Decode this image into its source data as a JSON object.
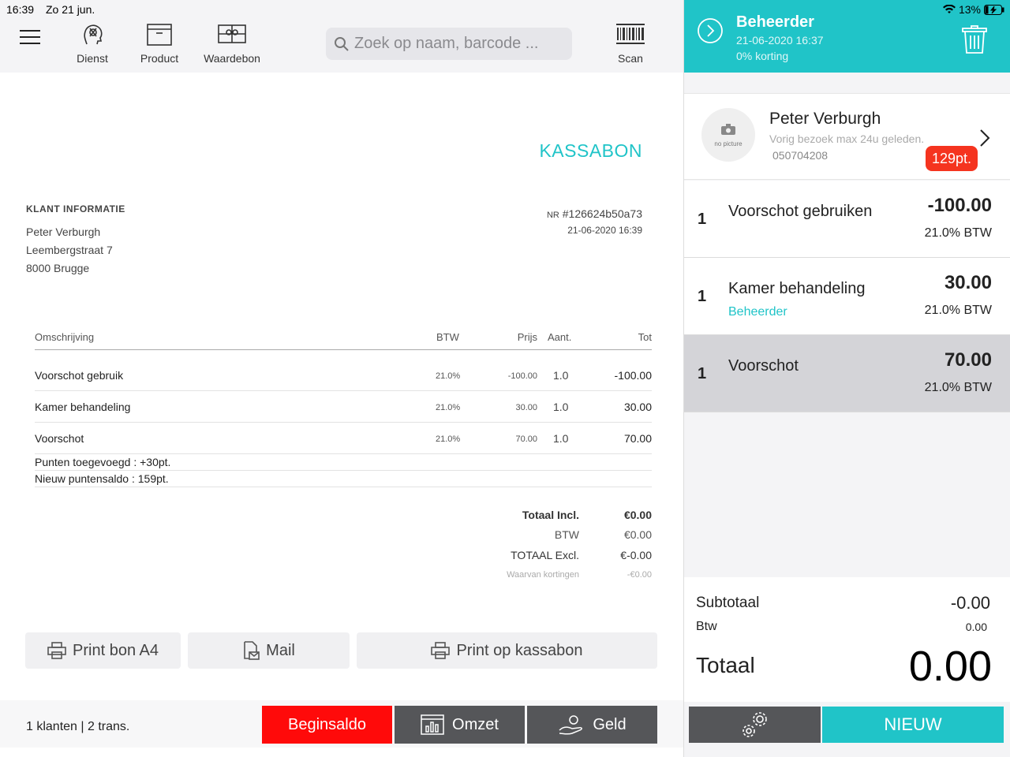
{
  "status": {
    "time": "16:39",
    "date": "Zo 21 jun.",
    "battery": "13%"
  },
  "toolbar": {
    "dienst": "Dienst",
    "product": "Product",
    "waardebon": "Waardebon",
    "search_placeholder": "Zoek op naam, barcode ...",
    "scan": "Scan"
  },
  "receipt": {
    "title": "KASSABON",
    "klant_heading": "KLANT INFORMATIE",
    "klant_name": "Peter Verburgh",
    "klant_street": "Leembergstraat 7",
    "klant_city": "8000 Brugge",
    "nr_label": "NR",
    "nr_value": "#126624b50a73",
    "datetime": "21-06-2020 16:39",
    "columns": {
      "desc": "Omschrijving",
      "btw": "BTW",
      "prijs": "Prijs",
      "aant": "Aant.",
      "tot": "Tot"
    },
    "rows": [
      {
        "desc": "Voorschot gebruik",
        "btw": "21.0%",
        "prijs": "-100.00",
        "aant": "1.0",
        "tot": "-100.00"
      },
      {
        "desc": "Kamer behandeling",
        "btw": "21.0%",
        "prijs": "30.00",
        "aant": "1.0",
        "tot": "30.00"
      },
      {
        "desc": "Voorschot",
        "btw": "21.0%",
        "prijs": "70.00",
        "aant": "1.0",
        "tot": "70.00"
      }
    ],
    "notes": [
      "Punten toegevoegd : +30pt.",
      "Nieuw puntensaldo : 159pt."
    ],
    "totals": {
      "incl_label": "Totaal Incl.",
      "incl_value": "€0.00",
      "btw_label": "BTW",
      "btw_value": "€0.00",
      "excl_label": "TOTAAL Excl.",
      "excl_value": "€-0.00",
      "korting_label": "Waarvan kortingen",
      "korting_value": "-€0.00"
    }
  },
  "actions": {
    "print_a4": "Print bon A4",
    "mail": "Mail",
    "print_kassabon": "Print op kassabon"
  },
  "footer": {
    "stats": "1 klanten | 2 trans.",
    "beginsaldo": "Beginsaldo",
    "omzet": "Omzet",
    "geld": "Geld"
  },
  "cart": {
    "user": "Beheerder",
    "datetime": "21-06-2020 16:37",
    "discount": "0% korting",
    "customer": {
      "name": "Peter Verburgh",
      "visit": "Vorig bezoek max 24u geleden.",
      "phone": "050704208",
      "points": "129pt.",
      "no_picture": "no picture"
    },
    "lines": [
      {
        "qty": "1",
        "name": "Voorschot gebruiken",
        "by": "",
        "price": "-100.00",
        "vat": "21.0% BTW"
      },
      {
        "qty": "1",
        "name": "Kamer behandeling",
        "by": "Beheerder",
        "price": "30.00",
        "vat": "21.0% BTW"
      },
      {
        "qty": "1",
        "name": "Voorschot",
        "by": "",
        "price": "70.00",
        "vat": "21.0% BTW"
      }
    ],
    "subtotal_label": "Subtotaal",
    "subtotal_value": "-0.00",
    "btw_label": "Btw",
    "btw_value": "0.00",
    "total_label": "Totaal",
    "total_value": "0.00",
    "nieuw": "NIEUW"
  },
  "colors": {
    "accent": "#20c4c8",
    "danger": "#ff0a0a",
    "dark_button": "#555659",
    "points_badge": "#f5341f"
  }
}
